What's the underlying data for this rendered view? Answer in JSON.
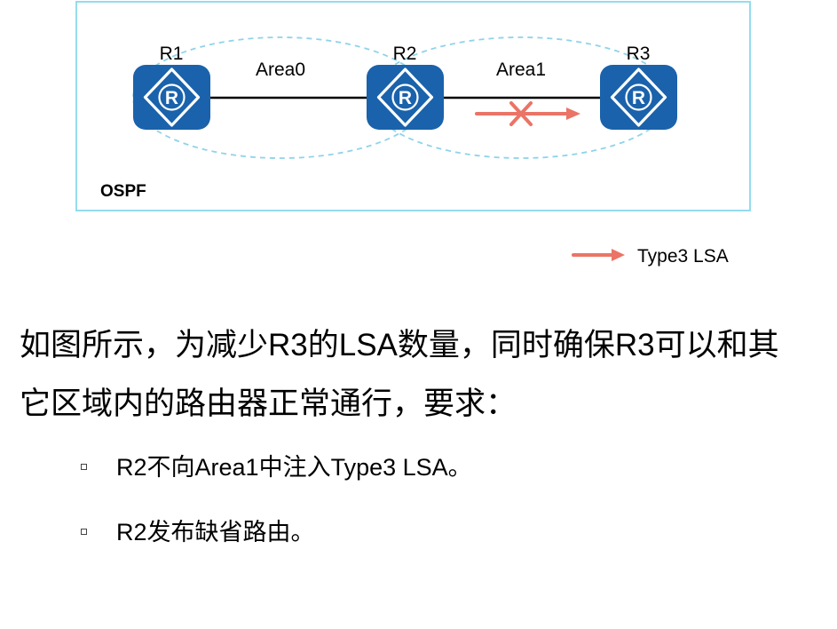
{
  "diagram": {
    "protocol_label": "OSPF",
    "routers": [
      {
        "name": "R1",
        "icon_letter": "R"
      },
      {
        "name": "R2",
        "icon_letter": "R"
      },
      {
        "name": "R3",
        "icon_letter": "R"
      }
    ],
    "areas": [
      {
        "name": "Area0"
      },
      {
        "name": "Area1"
      }
    ],
    "legend": {
      "label": "Type3 LSA"
    },
    "colors": {
      "router": "#1a62ab",
      "lsa_arrow": "#ea7466",
      "area_boundary": "#8fd3ea",
      "box_border": "#94dcef",
      "link": "#000000"
    }
  },
  "description": {
    "lines": [
      "如图所示，为减少R3的LSA数量，同时确保R3可以和其",
      "它区域内的路由器正常通行，要求："
    ]
  },
  "requirements": [
    {
      "text": "R2不向Area1中注入Type3 LSA。"
    },
    {
      "text": "R2发布缺省路由。"
    }
  ]
}
